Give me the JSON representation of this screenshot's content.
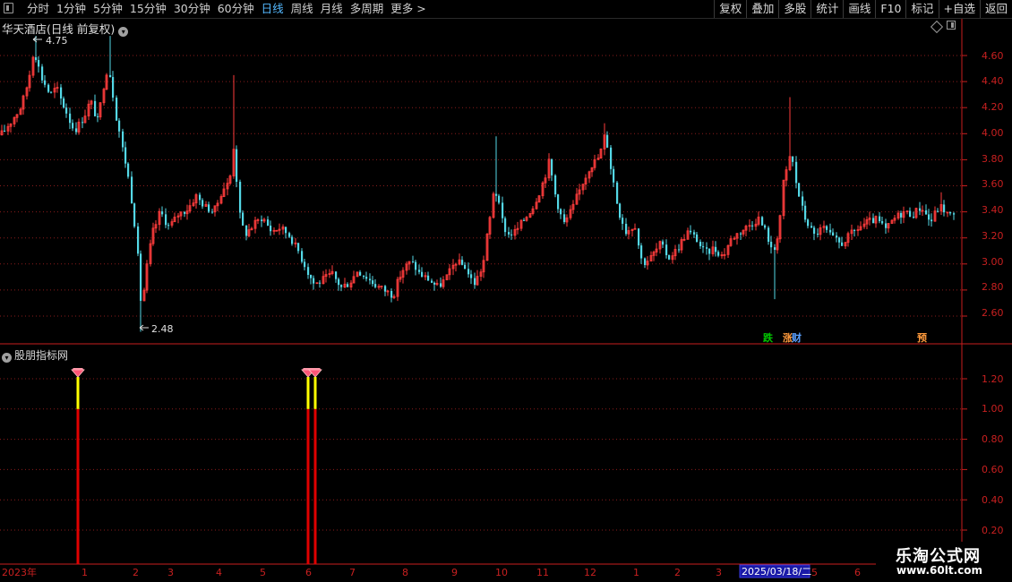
{
  "toolbar": {
    "periods": [
      {
        "label": "分时",
        "active": false
      },
      {
        "label": "1分钟",
        "active": false
      },
      {
        "label": "5分钟",
        "active": false
      },
      {
        "label": "15分钟",
        "active": false
      },
      {
        "label": "30分钟",
        "active": false
      },
      {
        "label": "60分钟",
        "active": false
      },
      {
        "label": "日线",
        "active": true
      },
      {
        "label": "周线",
        "active": false
      },
      {
        "label": "月线",
        "active": false
      },
      {
        "label": "多周期",
        "active": false
      },
      {
        "label": "更多",
        "active": false
      }
    ],
    "more_arrow": ">",
    "right_buttons": [
      "复权",
      "叠加",
      "多股",
      "统计",
      "画线",
      "F10",
      "标记",
      "+自选",
      "返回"
    ]
  },
  "main_chart": {
    "title": "华天酒店(日线 前复权)",
    "high_label": "4.75",
    "low_label": "2.48",
    "y_ticks": [
      "4.60",
      "4.40",
      "4.20",
      "4.00",
      "3.80",
      "3.60",
      "3.40",
      "3.20",
      "3.00",
      "2.80",
      "2.60"
    ],
    "markers": [
      {
        "text": "跌",
        "color": "#00c800"
      },
      {
        "text": "涨",
        "color": "#ff9a3c"
      },
      {
        "text": "财",
        "color": "#5aa0ff"
      },
      {
        "text": "预",
        "color": "#ff9a3c"
      }
    ]
  },
  "indicator": {
    "title": "股朋指标网",
    "y_ticks": [
      "1.20",
      "1.00",
      "0.80",
      "0.60",
      "0.40",
      "0.20"
    ],
    "signal_value": 1.0
  },
  "time_axis": {
    "labels": [
      "2023年",
      "1",
      "2",
      "3",
      "4",
      "5",
      "6",
      "7",
      "8",
      "9",
      "10",
      "11",
      "12",
      "1",
      "2",
      "3",
      "5",
      "6"
    ],
    "highlight": "2025/03/18/二"
  },
  "watermark": {
    "line1": "乐淘公式网",
    "line2": "www.60lt.com"
  },
  "colors": {
    "up": "#ff3c3c",
    "down": "#54d8e6",
    "axis": "#c81e1e",
    "grid": "#8a1c1c",
    "active": "#54b9ff"
  }
}
